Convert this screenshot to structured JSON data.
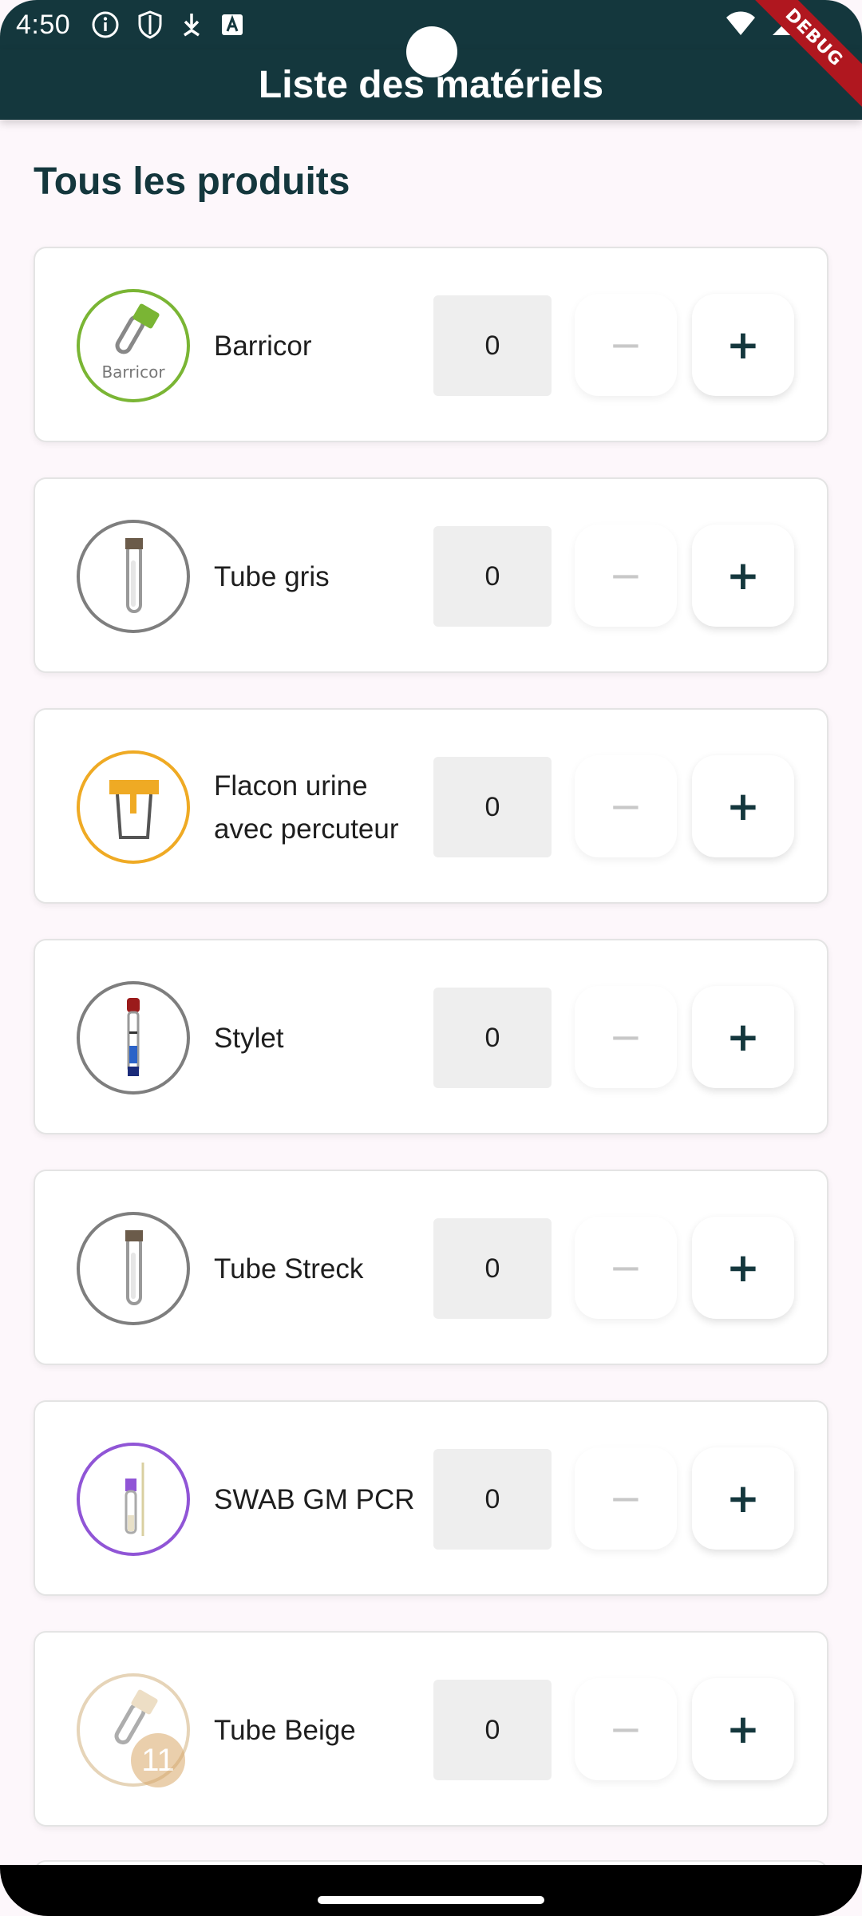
{
  "status_bar": {
    "time": "4:50",
    "left_icons": [
      "info-icon",
      "shield-icon",
      "download-icon",
      "font-icon"
    ],
    "right_icons": [
      "wifi-icon",
      "signal-icon",
      "battery-icon"
    ]
  },
  "app_bar": {
    "title": "Liste des matériels"
  },
  "debug_banner": "DEBUG",
  "section_title": "Tous les produits",
  "products": [
    {
      "name": "Barricor",
      "qty": "0",
      "icon": "barricor-tube-icon",
      "ring_color": "#7AB534",
      "icon_label": "Barricor"
    },
    {
      "name": "Tube gris",
      "qty": "0",
      "icon": "grey-tube-icon",
      "ring_color": "#7E7E7E"
    },
    {
      "name": "Flacon urine avec percuteur",
      "qty": "0",
      "icon": "urine-container-icon",
      "ring_color": "#EFAA24"
    },
    {
      "name": "Stylet",
      "qty": "0",
      "icon": "stylet-icon",
      "ring_color": "#7E7E7E"
    },
    {
      "name": "Tube Streck",
      "qty": "0",
      "icon": "streck-tube-icon",
      "ring_color": "#7E7E7E"
    },
    {
      "name": "SWAB GM PCR",
      "qty": "0",
      "icon": "swab-icon",
      "ring_color": "#9055D6"
    },
    {
      "name": "Tube Beige",
      "qty": "0",
      "icon": "beige-tube-icon",
      "ring_color": "#D7B98A",
      "badge": "11"
    }
  ],
  "buttons": {
    "minus_label": "−",
    "plus_label": "+"
  },
  "colors": {
    "primary": "#14373D",
    "background": "#FDF7FB",
    "qty_field": "#EEEEEE"
  }
}
